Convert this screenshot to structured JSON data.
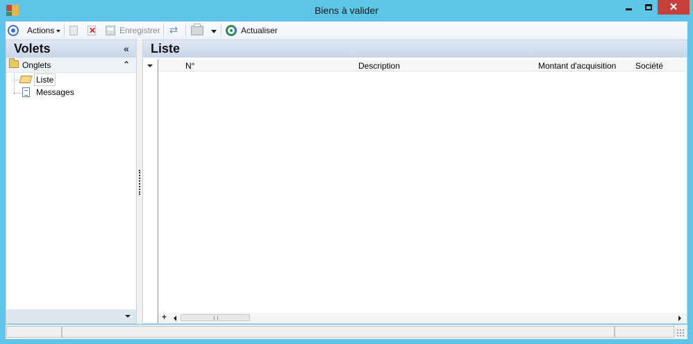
{
  "window": {
    "title": "Biens à valider",
    "controls": [
      "minimize",
      "maximize",
      "close"
    ],
    "close_color": "#c7413c",
    "frame_color": "#5fc5e8"
  },
  "toolbar": {
    "actions_label": "Actions",
    "save_label": "Enregistrer",
    "refresh_label": "Actualiser",
    "icons": [
      "target-icon",
      "new-document-icon",
      "delete-icon",
      "save-icon",
      "sync-icon",
      "print-icon",
      "refresh-icon"
    ]
  },
  "left_pane": {
    "title": "Volets",
    "collapse_glyph": "«",
    "group": {
      "label": "Onglets",
      "toggle_glyph": "⌃"
    },
    "items": [
      {
        "label": "Liste",
        "selected": true,
        "icon": "open-folder-icon"
      },
      {
        "label": "Messages",
        "selected": false,
        "icon": "document-icon"
      }
    ]
  },
  "main": {
    "title": "Liste",
    "grid": {
      "columns": [
        "N°",
        "Description",
        "Montant d'acquisition",
        "Société"
      ],
      "rows": []
    },
    "add_glyph": "+"
  },
  "status_bar": {
    "cells": [
      "",
      "",
      ""
    ]
  }
}
